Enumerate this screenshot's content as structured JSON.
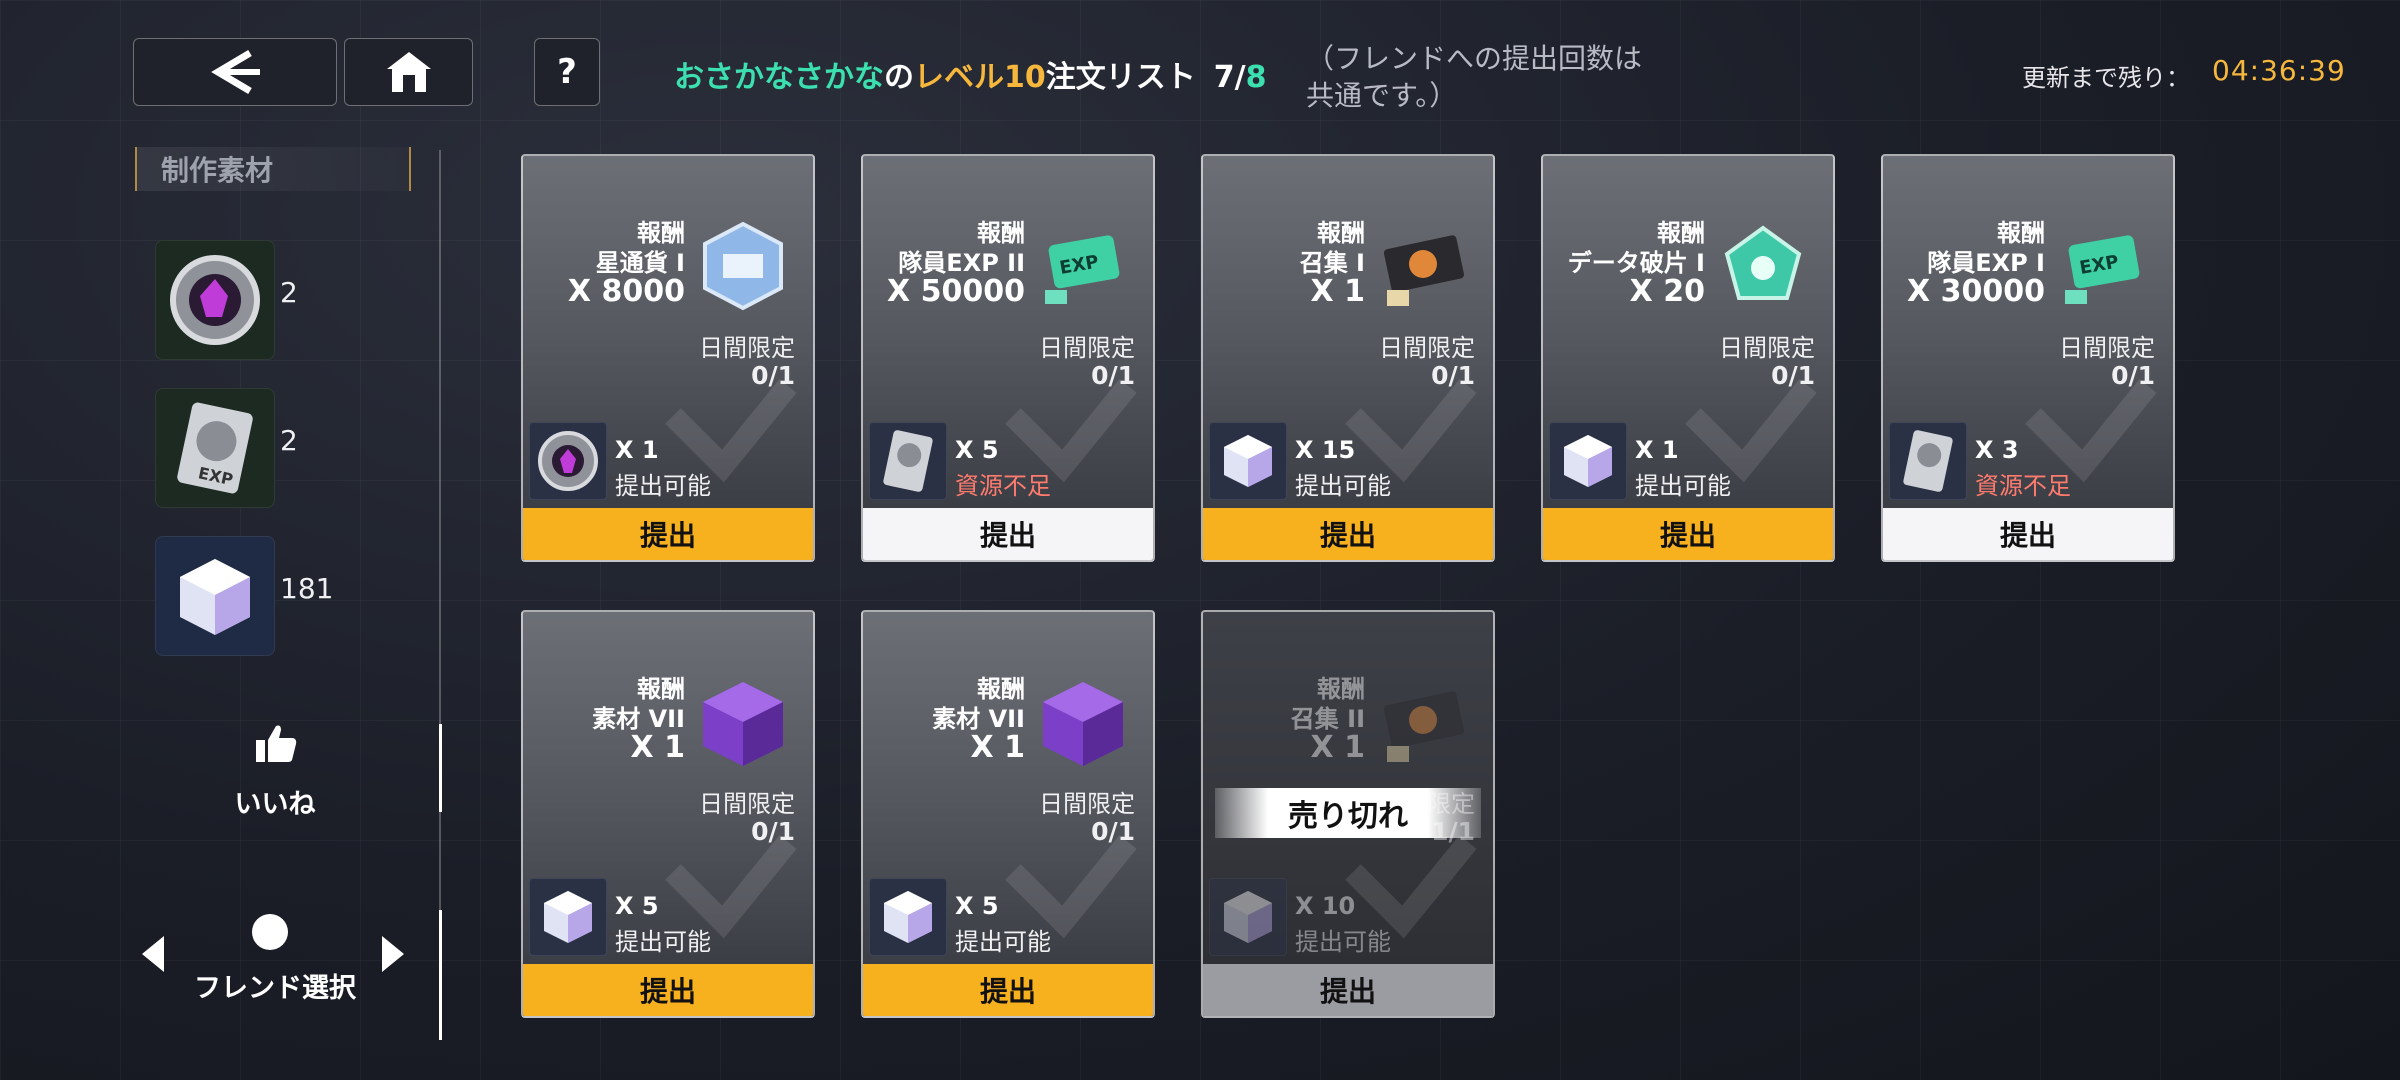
{
  "header": {
    "title_name": "おさかなさかな",
    "title_no": "の",
    "title_level": "レベル10",
    "title_rest": "注文リスト",
    "count_done": "7/",
    "count_total": "8",
    "note": "（フレンドへの提出回数は共通です。）",
    "refresh_label": "更新まで残り：",
    "refresh_time": "04:36:39"
  },
  "sidebar": {
    "materials_title": "制作素材",
    "materials": [
      {
        "icon": "purple-crystal-disc-icon",
        "count": "2"
      },
      {
        "icon": "exp-hard-drive-icon",
        "count": "2"
      },
      {
        "icon": "crystal-cube-icon",
        "count": "181"
      }
    ],
    "like_label": "いいね",
    "friend_select_label": "フレンド選択"
  },
  "cards": [
    {
      "reward_head": "報酬",
      "reward_name": "星通貨 I",
      "reward_qty": "X 8000",
      "reward_icon": "star-currency-icon",
      "daily_label": "日間限定",
      "daily_value": "0/1",
      "req_icon": "purple-crystal-disc-icon",
      "req_qty": "X 1",
      "req_status": "提出可能",
      "req_ok": true,
      "button": "提出",
      "button_style": "yellow"
    },
    {
      "reward_head": "報酬",
      "reward_name": "隊員EXP II",
      "reward_qty": "X 50000",
      "reward_icon": "exp-card-icon",
      "daily_label": "日間限定",
      "daily_value": "0/1",
      "req_icon": "exp-hard-drive-icon",
      "req_qty": "X 5",
      "req_status": "資源不足",
      "req_ok": false,
      "button": "提出",
      "button_style": "white"
    },
    {
      "reward_head": "報酬",
      "reward_name": "召集 I",
      "reward_qty": "X 1",
      "reward_icon": "recruit-ticket-icon",
      "daily_label": "日間限定",
      "daily_value": "0/1",
      "req_icon": "crystal-cube-icon",
      "req_qty": "X 15",
      "req_status": "提出可能",
      "req_ok": true,
      "button": "提出",
      "button_style": "yellow"
    },
    {
      "reward_head": "報酬",
      "reward_name": "データ破片 I",
      "reward_qty": "X 20",
      "reward_icon": "data-fragment-icon",
      "daily_label": "日間限定",
      "daily_value": "0/1",
      "req_icon": "crystal-cube-icon",
      "req_qty": "X 1",
      "req_status": "提出可能",
      "req_ok": true,
      "button": "提出",
      "button_style": "yellow"
    },
    {
      "reward_head": "報酬",
      "reward_name": "隊員EXP I",
      "reward_qty": "X 30000",
      "reward_icon": "exp-card-icon",
      "daily_label": "日間限定",
      "daily_value": "0/1",
      "req_icon": "exp-hard-drive-icon",
      "req_qty": "X 3",
      "req_status": "資源不足",
      "req_ok": false,
      "button": "提出",
      "button_style": "white"
    },
    {
      "reward_head": "報酬",
      "reward_name": "素材 VII",
      "reward_qty": "X 1",
      "reward_icon": "purple-cube-icon",
      "daily_label": "日間限定",
      "daily_value": "0/1",
      "req_icon": "crystal-cube-icon",
      "req_qty": "X 5",
      "req_status": "提出可能",
      "req_ok": true,
      "button": "提出",
      "button_style": "yellow"
    },
    {
      "reward_head": "報酬",
      "reward_name": "素材 VII",
      "reward_qty": "X 1",
      "reward_icon": "purple-cube-icon",
      "daily_label": "日間限定",
      "daily_value": "0/1",
      "req_icon": "crystal-cube-icon",
      "req_qty": "X 5",
      "req_status": "提出可能",
      "req_ok": true,
      "button": "提出",
      "button_style": "yellow"
    },
    {
      "reward_head": "報酬",
      "reward_name": "召集 II",
      "reward_qty": "X 1",
      "reward_icon": "recruit-ticket-icon",
      "daily_label": "日間限定",
      "daily_value": "1/1",
      "req_icon": "crystal-cube-icon",
      "req_qty": "X 10",
      "req_status": "提出可能",
      "req_ok": true,
      "button": "提出",
      "button_style": "gray",
      "sold_out": "売り切れ"
    }
  ],
  "colors": {
    "accent_yellow": "#f7b01e",
    "title_green": "#3ce0b0",
    "title_orange": "#f6b73c",
    "warn_red": "#ff7b6e"
  }
}
